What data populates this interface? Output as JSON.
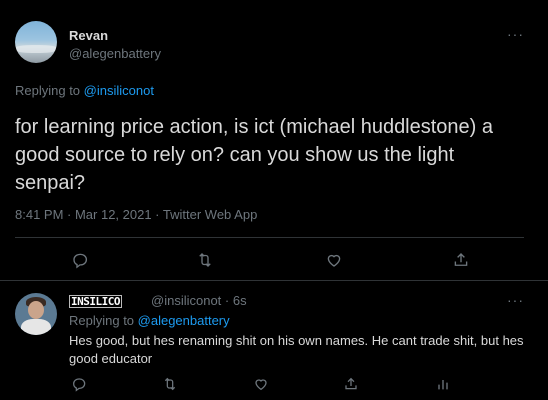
{
  "main_tweet": {
    "author_name": "Revan",
    "author_handle": "@alegenbattery",
    "more_label": "···",
    "replying_prefix": "Replying to ",
    "replying_to": "@insiliconot",
    "text": "for learning price action, is ict (michael huddlestone) a good source to rely on? can you show us the light senpai?",
    "timestamp": "8:41 PM · Mar 12, 2021 · Twitter Web App",
    "actions": [
      "reply-icon",
      "retweet-icon",
      "like-icon",
      "share-icon"
    ]
  },
  "reply": {
    "author_name": "INSILICO",
    "author_handle": "@insiliconot",
    "time": " · 6s",
    "more_label": "···",
    "replying_prefix": "Replying to ",
    "replying_to": "@alegenbattery",
    "text": "Hes good, but hes renaming shit on his own names. He cant trade shit, but hes good educator",
    "actions": [
      "reply-icon",
      "retweet-icon",
      "like-icon",
      "share-icon",
      "analytics-icon"
    ]
  },
  "colors": {
    "background": "#000000",
    "text": "#d9d9d9",
    "secondary": "#6e767d",
    "accent": "#1d9bf0",
    "divider": "#2f3336"
  }
}
